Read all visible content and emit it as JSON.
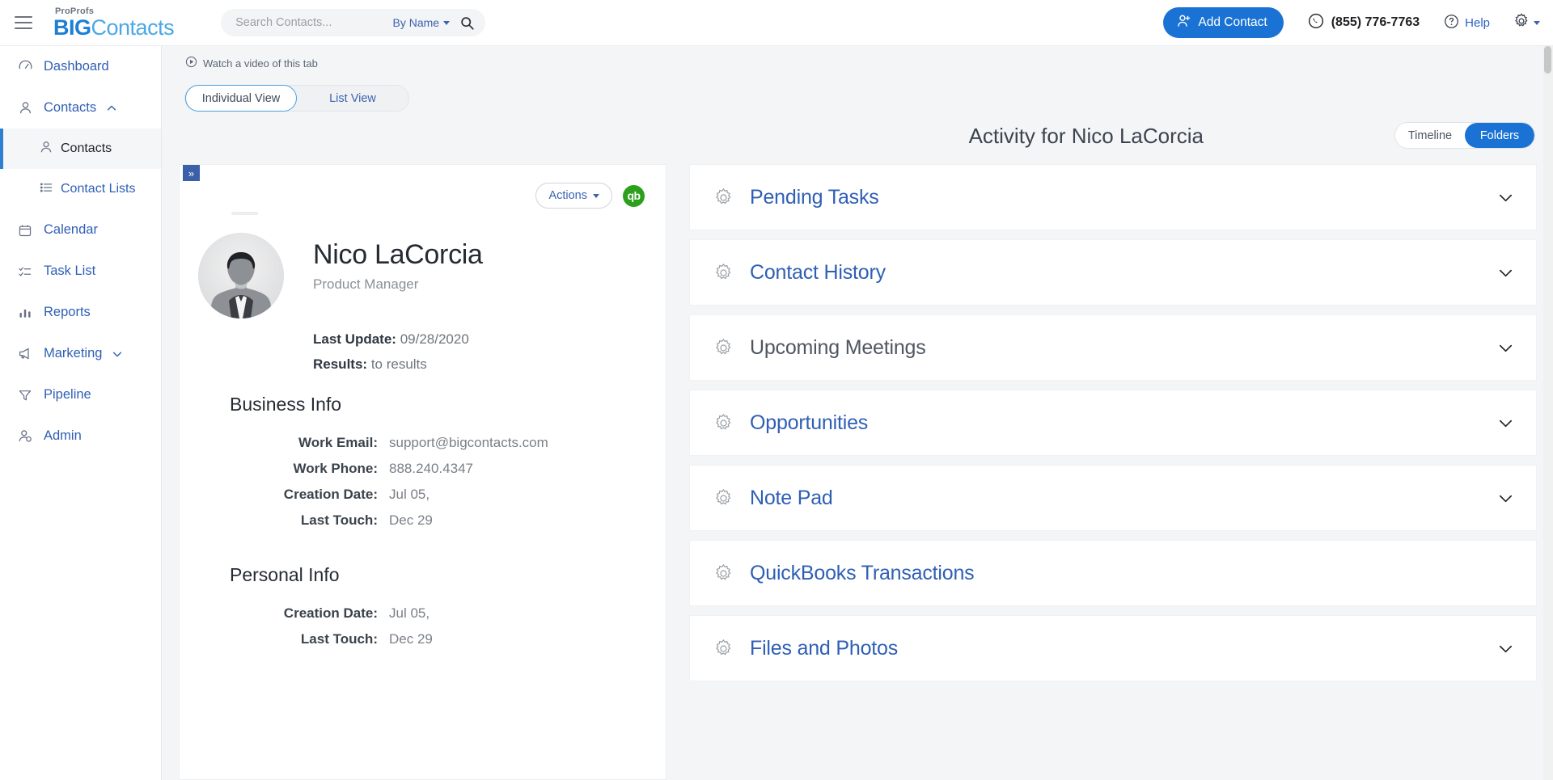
{
  "header": {
    "menu_icon": "hamburger-menu-icon",
    "brand_top": "ProProfs",
    "brand_big": "BIG",
    "brand_contacts": "Contacts",
    "search": {
      "placeholder": "Search Contacts...",
      "value": "",
      "filter_label": "By Name",
      "search_icon": "search-icon"
    },
    "add_contact_label": "Add Contact",
    "add_contact_icon": "add-user-icon",
    "phone": "(855) 776-7763",
    "phone_icon": "phone-icon",
    "help_label": "Help",
    "help_icon": "question-circle-icon",
    "settings_icon": "gear-icon"
  },
  "sidebar": {
    "items": [
      {
        "label": "Dashboard",
        "icon": "speedometer-icon",
        "chevron": "",
        "active": false
      },
      {
        "label": "Contacts",
        "icon": "user-icon",
        "chevron": "up",
        "active": false
      },
      {
        "label": "Calendar",
        "icon": "calendar-icon",
        "chevron": "",
        "active": false
      },
      {
        "label": "Task List",
        "icon": "checklist-icon",
        "chevron": "",
        "active": false
      },
      {
        "label": "Reports",
        "icon": "bar-chart-icon",
        "chevron": "",
        "active": false
      },
      {
        "label": "Marketing",
        "icon": "megaphone-icon",
        "chevron": "down",
        "active": false
      },
      {
        "label": "Pipeline",
        "icon": "funnel-icon",
        "chevron": "",
        "active": false
      },
      {
        "label": "Admin",
        "icon": "user-gear-icon",
        "chevron": "",
        "active": false
      }
    ],
    "sub_items": [
      {
        "label": "Contacts",
        "icon": "user-icon",
        "active": true
      },
      {
        "label": "Contact Lists",
        "icon": "list-icon",
        "active": false
      }
    ]
  },
  "main": {
    "watch_video_label": "Watch a video of this tab",
    "watch_video_icon": "play-circle-icon",
    "view_tabs": [
      {
        "label": "Individual View",
        "active": true
      },
      {
        "label": "List View",
        "active": false
      }
    ],
    "activity_title": "Activity for Nico LaCorcia",
    "activity_toggle": [
      {
        "label": "Timeline",
        "active": false
      },
      {
        "label": "Folders",
        "active": true
      }
    ]
  },
  "contact_card": {
    "expander_icon": "double-chevron-right-icon",
    "actions_label": "Actions",
    "quickbooks_badge": "qb",
    "avatar": "contact-avatar-photo",
    "name": "Nico LaCorcia",
    "role": "Product Manager",
    "meta": [
      {
        "label": "Last Update:",
        "value": "09/28/2020"
      },
      {
        "label": "Results:",
        "value": "to results"
      }
    ],
    "business_info": {
      "title": "Business Info",
      "fields": [
        {
          "label": "Work Email",
          "value": "support@bigcontacts.com"
        },
        {
          "label": "Work Phone",
          "value": "888.240.4347"
        },
        {
          "label": "Creation Date",
          "value": "Jul 05,"
        },
        {
          "label": "Last Touch",
          "value": "Dec 29"
        }
      ]
    },
    "personal_info": {
      "title": "Personal Info",
      "fields": [
        {
          "label": "Creation Date",
          "value": "Jul 05,"
        },
        {
          "label": "Last Touch",
          "value": "Dec 29"
        }
      ]
    }
  },
  "folders": [
    {
      "label": "Pending Tasks",
      "icon": "gear-icon",
      "chevron": true,
      "muted": false
    },
    {
      "label": "Contact History",
      "icon": "gear-icon",
      "chevron": true,
      "muted": false
    },
    {
      "label": "Upcoming Meetings",
      "icon": "gear-icon",
      "chevron": true,
      "muted": true
    },
    {
      "label": "Opportunities",
      "icon": "gear-icon",
      "chevron": true,
      "muted": false
    },
    {
      "label": "Note Pad",
      "icon": "gear-icon",
      "chevron": true,
      "muted": false
    },
    {
      "label": "QuickBooks Transactions",
      "icon": "gear-icon",
      "chevron": false,
      "muted": false
    },
    {
      "label": "Files and Photos",
      "icon": "gear-icon",
      "chevron": true,
      "muted": false
    }
  ],
  "colors": {
    "accent_blue": "#1a73d4",
    "link_blue": "#2f5fb5",
    "quickbooks_green": "#2ca01c",
    "page_bg": "#f4f5f7"
  }
}
